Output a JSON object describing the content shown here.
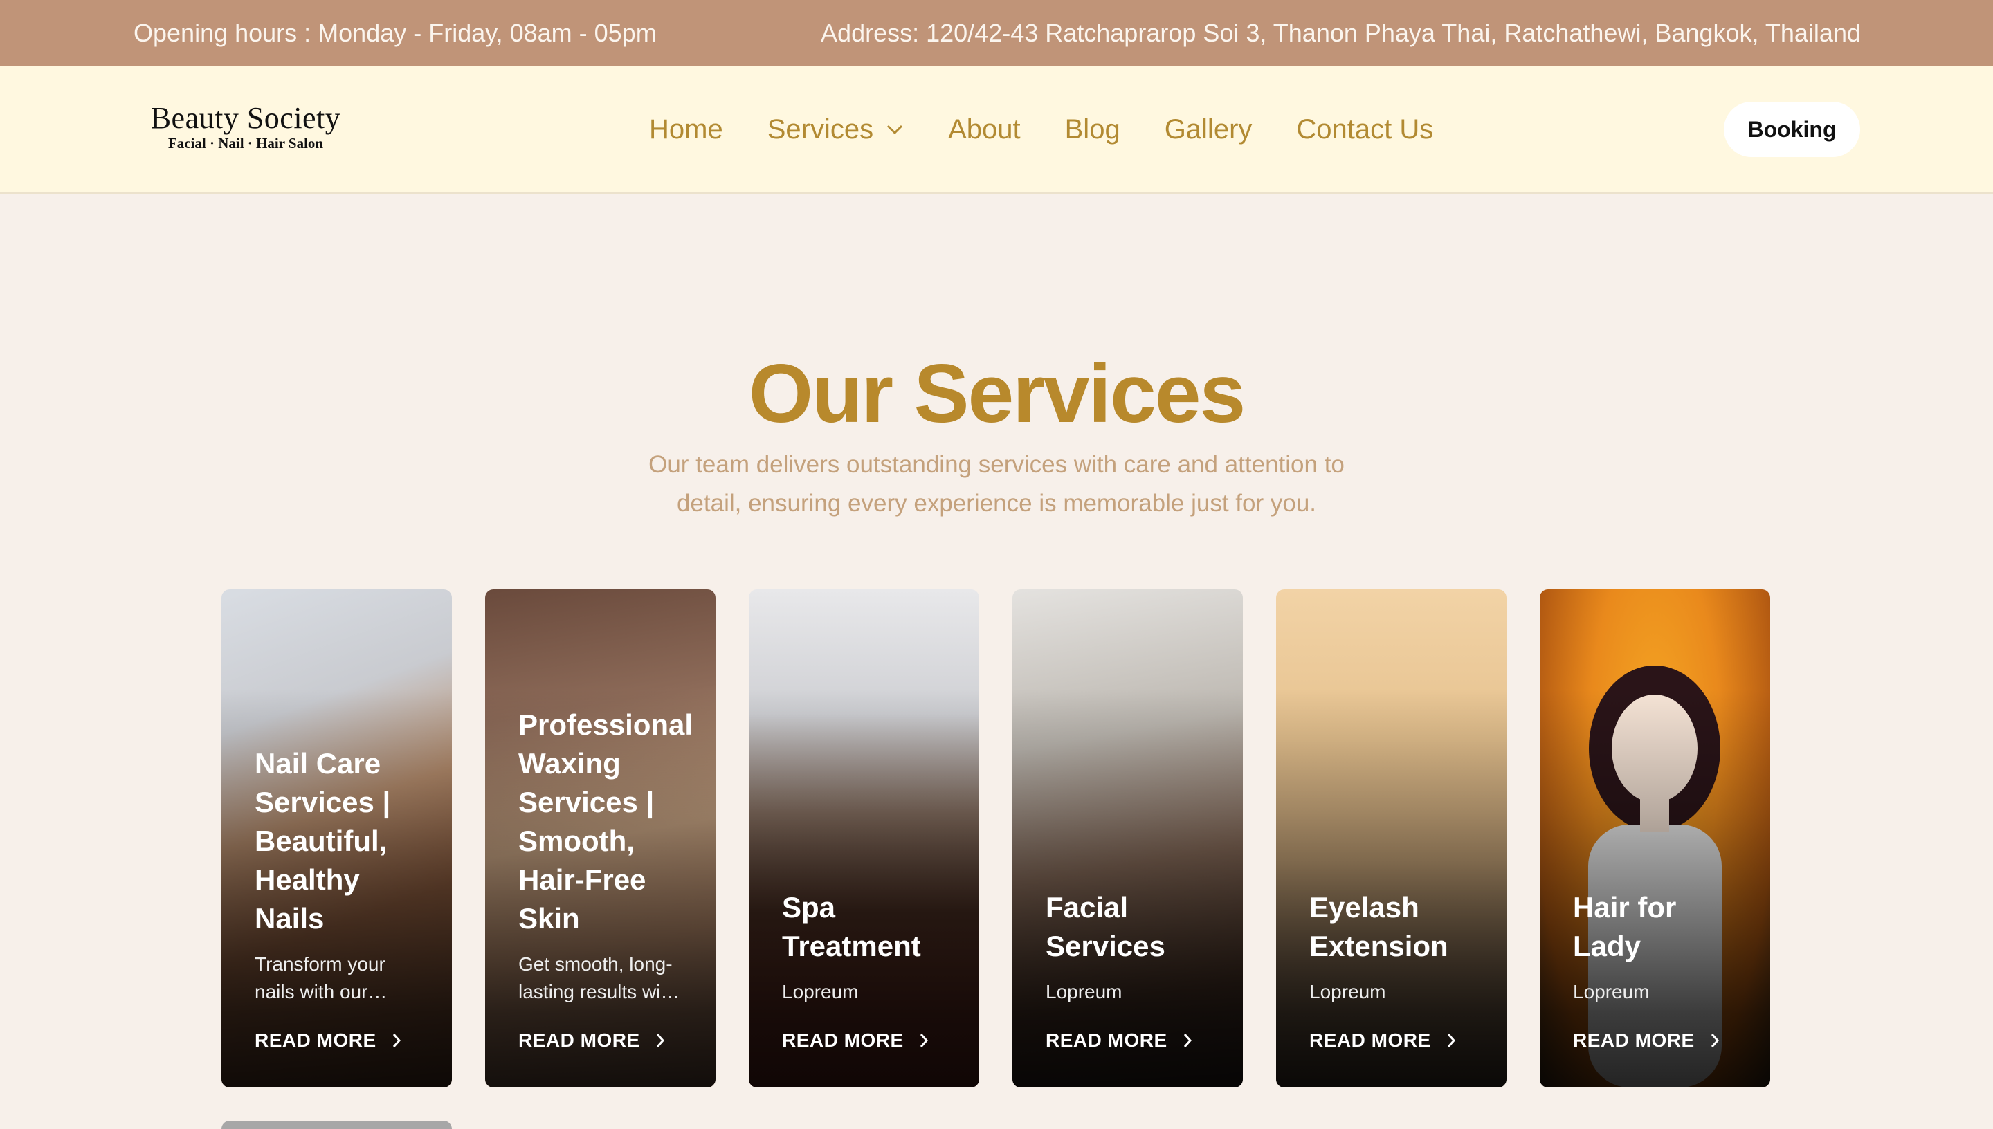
{
  "topbar": {
    "hours": "Opening hours : Monday - Friday, 08am - 05pm",
    "address": "Address: 120/42-43 Ratchaprarop Soi 3, Thanon Phaya Thai, Ratchathewi, Bangkok, Thailand"
  },
  "header": {
    "logo_title": "Beauty Society",
    "logo_subtitle": "Facial · Nail · Hair Salon",
    "nav": [
      "Home",
      "Services",
      "About",
      "Blog",
      "Gallery",
      "Contact Us"
    ],
    "booking_label": "Booking"
  },
  "section": {
    "title": "Our Services",
    "subtitle": "Our team delivers outstanding services with care and attention to detail, ensuring every experience is memorable just for you."
  },
  "cards": [
    {
      "title": "Nail Care Services | Beautiful, Healthy Nails",
      "desc": "Transform your nails with our…",
      "more": "READ MORE"
    },
    {
      "title": "Professional Waxing Services | Smooth, Hair-Free Skin",
      "desc": "Get smooth, long-lasting results wi…",
      "more": "READ MORE"
    },
    {
      "title": "Spa Treatment",
      "desc": "Lopreum",
      "more": "READ MORE"
    },
    {
      "title": "Facial Services",
      "desc": "Lopreum",
      "more": "READ MORE"
    },
    {
      "title": "Eyelash Extension",
      "desc": "Lopreum",
      "more": "READ MORE"
    },
    {
      "title": "Hair for Lady",
      "desc": "Lopreum",
      "more": "READ MORE"
    }
  ],
  "colors": {
    "topbar_bg": "#c09478",
    "header_bg": "#fff8e0",
    "accent_gold": "#b8892c",
    "page_bg": "#f7f0ea"
  },
  "icons": {
    "nav_dropdown": "chevron-down-icon",
    "read_more": "chevron-right-icon"
  }
}
